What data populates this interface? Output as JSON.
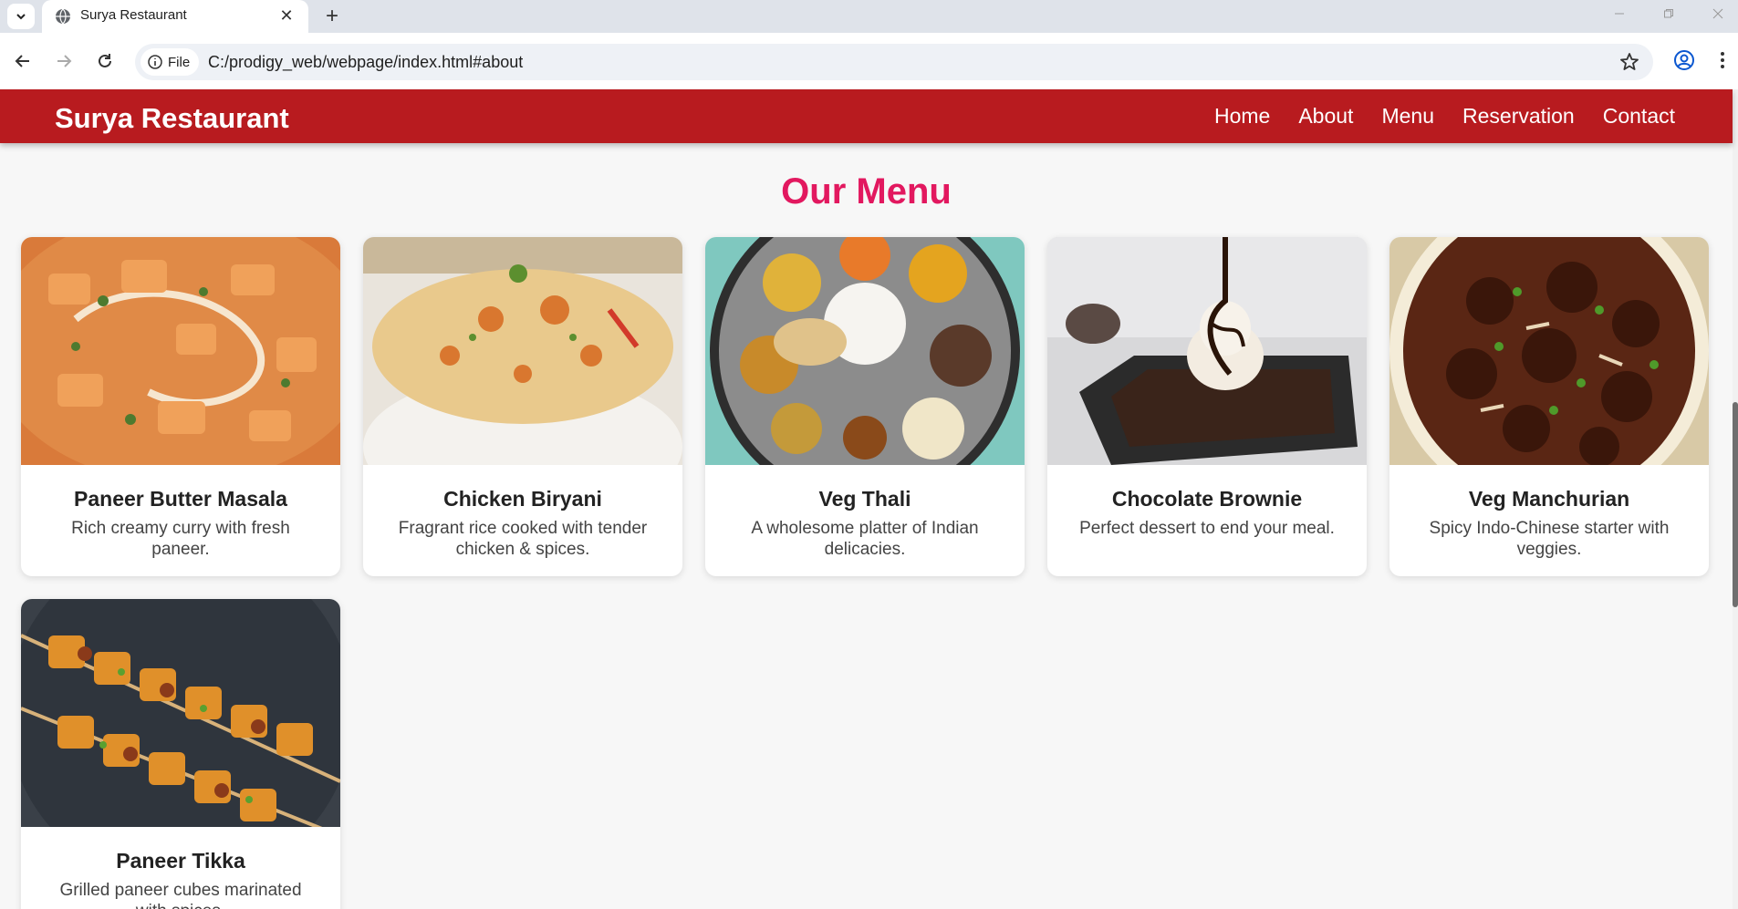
{
  "browser": {
    "tab_title": "Surya Restaurant",
    "address_chip": "File",
    "url": "C:/prodigy_web/webpage/index.html#about"
  },
  "site": {
    "brand": "Surya Restaurant",
    "nav": [
      "Home",
      "About",
      "Menu",
      "Reservation",
      "Contact"
    ],
    "menu_heading": "Our Menu"
  },
  "menu_items": [
    {
      "name": "Paneer Butter Masala",
      "description": "Rich creamy curry with fresh paneer.",
      "image": "paneer-butter-masala-photo"
    },
    {
      "name": "Chicken Biryani",
      "description": "Fragrant rice cooked with tender chicken & spices.",
      "image": "chicken-biryani-photo"
    },
    {
      "name": "Veg Thali",
      "description": "A wholesome platter of Indian delicacies.",
      "image": "veg-thali-photo"
    },
    {
      "name": "Chocolate Brownie",
      "description": "Perfect dessert to end your meal.",
      "image": "chocolate-brownie-photo"
    },
    {
      "name": "Veg Manchurian",
      "description": "Spicy Indo-Chinese starter with veggies.",
      "image": "veg-manchurian-photo"
    },
    {
      "name": "Paneer Tikka",
      "description": "Grilled paneer cubes marinated with spices.",
      "image": "paneer-tikka-photo"
    }
  ],
  "colors": {
    "header_red": "#b81b1f",
    "heading_pink": "#e2185f",
    "page_bg": "#f7f7f7"
  }
}
